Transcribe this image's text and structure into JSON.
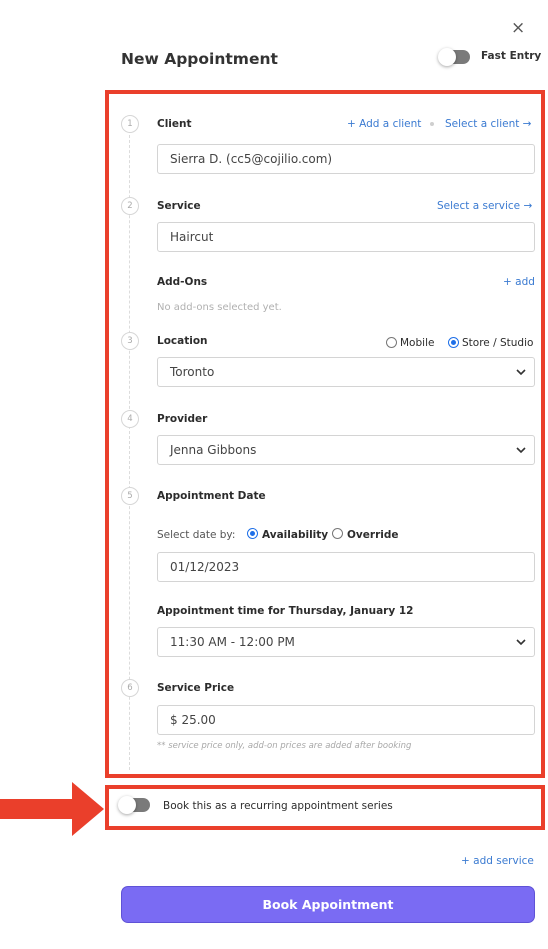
{
  "modal": {
    "close": "×",
    "title": "New Appointment",
    "fast_entry_label": "Fast Entry"
  },
  "client": {
    "step": "1",
    "label": "Client",
    "add_link": "+ Add a client",
    "select_link": "Select a client →",
    "value": "Sierra D. (cc5@cojilio.com)"
  },
  "service": {
    "step": "2",
    "label": "Service",
    "select_link": "Select a service →",
    "value": "Haircut"
  },
  "addons": {
    "label": "Add-Ons",
    "add_link": "+ add",
    "empty_text": "No add-ons selected yet."
  },
  "location": {
    "step": "3",
    "label": "Location",
    "option_mobile": "Mobile",
    "option_store": "Store / Studio",
    "value": "Toronto"
  },
  "provider": {
    "step": "4",
    "label": "Provider",
    "value": "Jenna Gibbons"
  },
  "date": {
    "step": "5",
    "label": "Appointment Date",
    "select_by_label": "Select date by:",
    "option_availability": "Availability",
    "option_override": "Override",
    "value": "01/12/2023",
    "time_label": "Appointment time for Thursday, January 12",
    "time_value": "11:30 AM - 12:00 PM"
  },
  "price": {
    "step": "6",
    "label": "Service Price",
    "value": "$ 25.00",
    "note": "** service price only, add-on prices are added after booking"
  },
  "recurring": {
    "label": "Book this as a recurring appointment series"
  },
  "footer": {
    "add_service": "+ add service",
    "book_button": "Book Appointment"
  },
  "colors": {
    "highlight": "#ea3f2b",
    "link": "#3a7ad1",
    "primary_button": "#7a6bf3",
    "radio_selected": "#1e6fe8"
  }
}
